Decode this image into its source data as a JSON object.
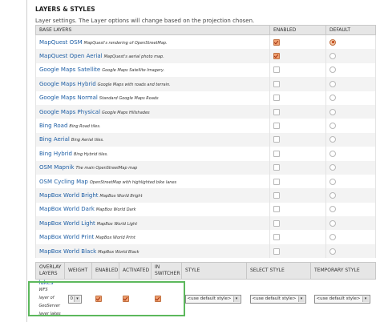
{
  "section": {
    "title": "LAYERS & STYLES",
    "description": "Layer settings. The Layer options will change based on the projection chosen."
  },
  "base_layers": {
    "headers": [
      "BASE LAYERS",
      "ENABLED",
      "DEFAULT"
    ],
    "rows": [
      {
        "name": "MapQuest OSM",
        "desc": "MapQuest's rendering of OpenStreetMap.",
        "enabled": true,
        "default": true
      },
      {
        "name": "MapQuest Open Aerial",
        "desc": "MapQuest's aerial photo map.",
        "enabled": true,
        "default": false
      },
      {
        "name": "Google Maps Satellite",
        "desc": "Google Maps Satellite Imagery.",
        "enabled": false,
        "default": false
      },
      {
        "name": "Google Maps Hybrid",
        "desc": "Google Maps with roads and terrain.",
        "enabled": false,
        "default": false
      },
      {
        "name": "Google Maps Normal",
        "desc": "Standard Google Maps Roads",
        "enabled": false,
        "default": false
      },
      {
        "name": "Google Maps Physical",
        "desc": "Google Maps Hillshades",
        "enabled": false,
        "default": false
      },
      {
        "name": "Bing Road",
        "desc": "Bing Road tiles.",
        "enabled": false,
        "default": false
      },
      {
        "name": "Bing Aerial",
        "desc": "Bing Aerial tiles.",
        "enabled": false,
        "default": false
      },
      {
        "name": "Bing Hybrid",
        "desc": "Bing Hybrid tiles.",
        "enabled": false,
        "default": false
      },
      {
        "name": "OSM Mapnik",
        "desc": "The main OpenStreetMap map",
        "enabled": false,
        "default": false
      },
      {
        "name": "OSM Cycling Map",
        "desc": "OpenStreetMap with highlighted bike lanes",
        "enabled": false,
        "default": false
      },
      {
        "name": "MapBox World Bright",
        "desc": "MapBox World Bright",
        "enabled": false,
        "default": false
      },
      {
        "name": "MapBox World Dark",
        "desc": "MapBox World Dark",
        "enabled": false,
        "default": false
      },
      {
        "name": "MapBox World Light",
        "desc": "MapBox World Light",
        "enabled": false,
        "default": false
      },
      {
        "name": "MapBox World Print",
        "desc": "MapBox World Print",
        "enabled": false,
        "default": false
      },
      {
        "name": "MapBox World Black",
        "desc": "MapBox World Black",
        "enabled": false,
        "default": false
      }
    ]
  },
  "overlay_layers": {
    "headers": {
      "layers_line1": "OVERLAY",
      "layers_line2": "LAYERS",
      "weight": "WEIGHT",
      "enabled": "ENABLED",
      "activated": "ACTIVATED",
      "switcher_line1": "IN",
      "switcher_line2": "SWITCHER",
      "style": "STYLE",
      "select_style": "SELECT STYLE",
      "temporary_style": "TEMPORARY STYLE"
    },
    "rows": [
      {
        "name": "lakes",
        "type": "WFS",
        "desc_line1": "layer of",
        "desc_line2": "GeoServer",
        "desc_line3": "layer lakes",
        "weight": "0",
        "enabled": true,
        "activated": true,
        "in_switcher": true,
        "style": "<use default style>",
        "select_style": "<use default style>",
        "temporary_style": "<use default style>"
      }
    ]
  },
  "colors": {
    "link": "#1f5fa5",
    "highlight": "#5cb85c",
    "checkbox_checked": "#f0a070"
  }
}
